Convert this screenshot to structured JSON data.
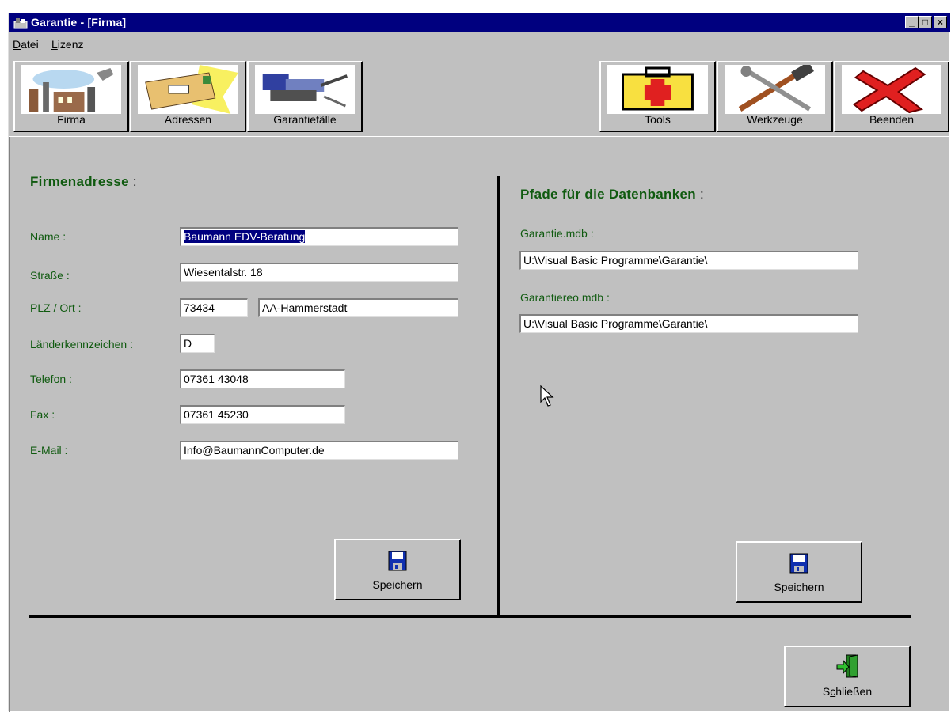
{
  "window": {
    "title": "Garantie - [Firma]",
    "controls": {
      "minimize": "_",
      "maximize": "□",
      "close": "×"
    }
  },
  "menu": [
    {
      "label": "Datei",
      "accel": "D",
      "rest": "atei"
    },
    {
      "label": "Lizenz",
      "accel": "L",
      "rest": "izenz"
    }
  ],
  "toolbar": {
    "left": [
      {
        "label": "Firma",
        "icon": "factory-icon"
      },
      {
        "label": "Adressen",
        "icon": "envelope-icon"
      },
      {
        "label": "Garantiefälle",
        "icon": "vise-icon"
      }
    ],
    "right": [
      {
        "label": "Tools",
        "icon": "first-aid-kit-icon"
      },
      {
        "label": "Werkzeuge",
        "icon": "hammer-wrench-icon"
      },
      {
        "label": "Beenden",
        "icon": "red-x-icon"
      }
    ]
  },
  "company": {
    "heading": "Firmenadresse",
    "name_label": "Name :",
    "name": "Baumann EDV-Beratung",
    "street_label": "Straße :",
    "street": "Wiesentalstr. 18",
    "plz_ort_label": "PLZ / Ort :",
    "plz": "73434",
    "ort": "AA-Hammerstadt",
    "country_label": "Länderkennzeichen :",
    "country": "D",
    "phone_label": "Telefon :",
    "phone": "07361 43048",
    "fax_label": "Fax :",
    "fax": "07361 45230",
    "email_label": "E-Mail :",
    "email": "Info@BaumannComputer.de",
    "save_label": "Speichern"
  },
  "paths": {
    "heading": "Pfade für die Datenbanken",
    "garantie_label": "Garantie.mdb :",
    "garantie_path": "U:\\Visual Basic Programme\\Garantie\\",
    "garantieeo_label": "Garantiereo.mdb :",
    "garantieeo_path": "U:\\Visual Basic Programme\\Garantie\\",
    "save_label": "Speichern"
  },
  "close_button": {
    "label": "Schließen",
    "pre": "S",
    "accel": "c",
    "rest": "hließen"
  },
  "colors": {
    "titlebar": "#00007f",
    "face": "#c0c0c0",
    "label_green": "#0f5a0f",
    "selection": "#00007f"
  }
}
